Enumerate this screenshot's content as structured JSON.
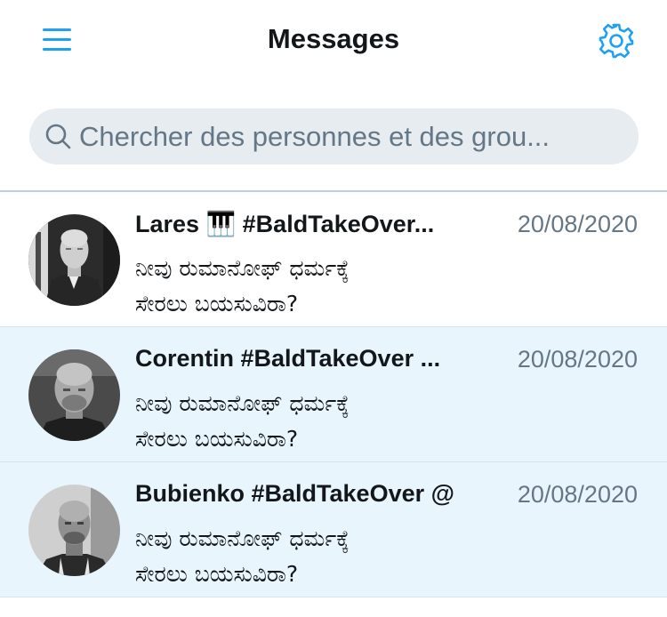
{
  "header": {
    "title": "Messages",
    "menu_icon": "hamburger-menu-icon",
    "settings_icon": "gear-icon"
  },
  "search": {
    "placeholder": "Chercher des personnes et des grou...",
    "icon": "search-icon"
  },
  "colors": {
    "accent": "#1da1f2",
    "unread_background": "#e8f5fd",
    "search_background": "#e6ecf0",
    "secondary_text": "#657786"
  },
  "conversations": [
    {
      "name": "Lares 🎹 #BaldTakeOver...",
      "date": "20/08/2020",
      "preview_line1": "ನೀವು ರುಮಾನೋಫ್ ಧರ್ಮಕ್ಕೆ",
      "preview_line2": "ಸೇರಲು ಬಯಸುವಿರಾ?",
      "unread": false
    },
    {
      "name": "Corentin #BaldTakeOver ...",
      "date": "20/08/2020",
      "preview_line1": "ನೀವು ರುಮಾನೋಫ್ ಧರ್ಮಕ್ಕೆ",
      "preview_line2": "ಸೇರಲು ಬಯಸುವಿರಾ?",
      "unread": true
    },
    {
      "name": "Bubienko #BaldTakeOver @",
      "date": "20/08/2020",
      "preview_line1": "ನೀವು ರುಮಾನೋಫ್ ಧರ್ಮಕ್ಕೆ",
      "preview_line2": "ಸೇರಲು ಬಯಸುವಿರಾ?",
      "unread": true
    }
  ]
}
